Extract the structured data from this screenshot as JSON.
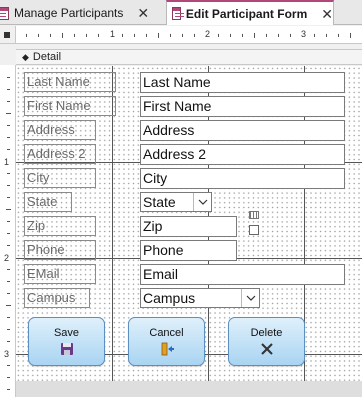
{
  "tabs": [
    {
      "label": "Manage Participants",
      "close": "✕",
      "active": false
    },
    {
      "label": "Edit Participant Form",
      "close": "✕",
      "active": true
    }
  ],
  "ruler": {
    "h_numbers": [
      "1",
      "2",
      "3"
    ],
    "v_numbers": [
      "1",
      "2",
      "3"
    ]
  },
  "section": {
    "label": "Detail"
  },
  "fields": {
    "last_name": {
      "label": "Last Name",
      "value": "Last Name"
    },
    "first_name": {
      "label": "First Name",
      "value": "First Name"
    },
    "address": {
      "label": "Address",
      "value": "Address"
    },
    "address2": {
      "label": "Address 2",
      "value": "Address 2"
    },
    "city": {
      "label": "City",
      "value": "City"
    },
    "state": {
      "label": "State",
      "value": "State"
    },
    "zip": {
      "label": "Zip",
      "value": "Zip"
    },
    "phone": {
      "label": "Phone",
      "value": "Phone"
    },
    "email": {
      "label": "EMail",
      "value": "Email"
    },
    "campus": {
      "label": "Campus",
      "value": "Campus"
    }
  },
  "buttons": {
    "save": "Save",
    "cancel": "Cancel",
    "delete": "Delete"
  },
  "colors": {
    "accent": "#b0487a",
    "button_top": "#dff0fb",
    "button_bottom": "#a9d4f2"
  }
}
